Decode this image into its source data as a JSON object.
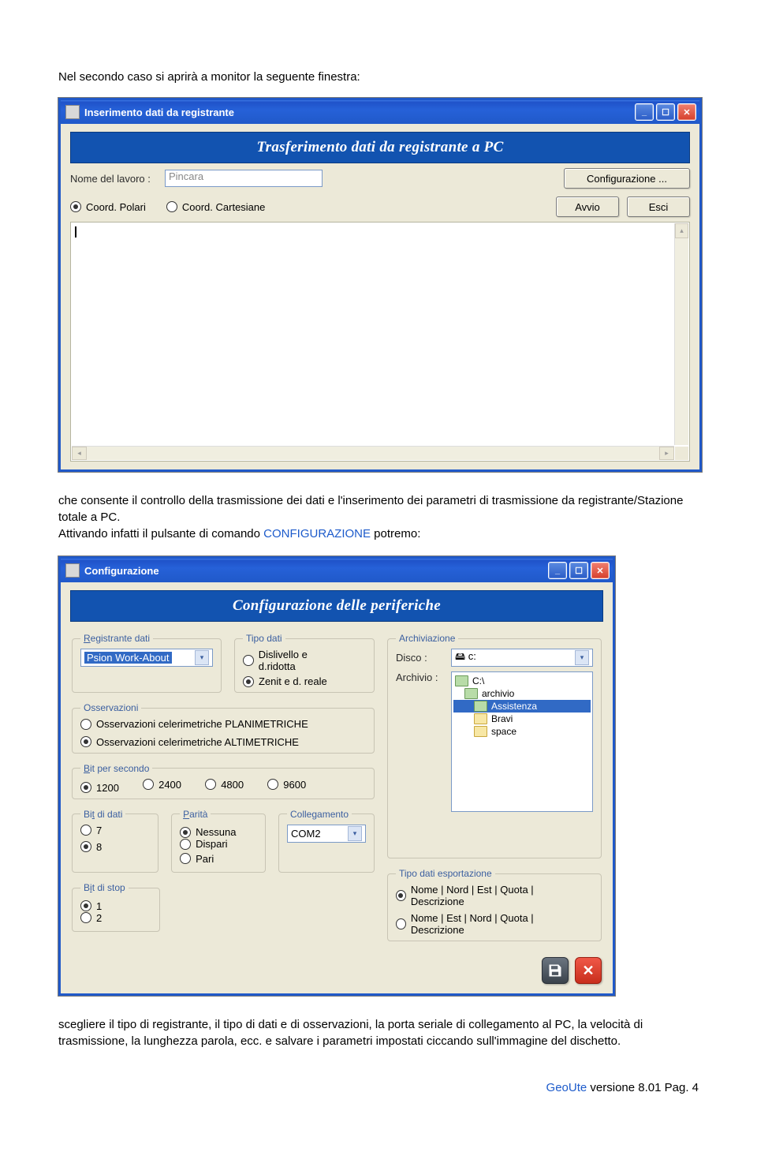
{
  "text": {
    "intro": "Nel secondo caso si aprirà a monitor la seguente finestra:",
    "caption1a": "che consente il controllo della trasmissione dei dati e l'inserimento dei parametri di trasmissione da registrante/Stazione totale a PC.",
    "caption1b": "Attivando infatti il pulsante di comando ",
    "caption1kw": "CONFIGURAZIONE",
    "caption1c": " potremo:",
    "caption2": "scegliere il tipo di registrante, il tipo di dati e di osservazioni, la porta seriale di collegamento al PC, la velocità di trasmissione, la lunghezza parola, ecc. e salvare i parametri impostati ciccando sull'immagine del dischetto."
  },
  "win1": {
    "title": "Inserimento dati da registrante",
    "banner": "Trasferimento dati da registrante a PC",
    "job_label": "Nome del lavoro :",
    "job_value": "Pincara",
    "config_btn": "Configurazione ...",
    "radio_polar": "Coord. Polari",
    "radio_cart": "Coord. Cartesiane",
    "btn_avvio": "Avvio",
    "btn_esci": "Esci"
  },
  "win2": {
    "title": "Configurazione",
    "banner": "Configurazione  delle periferiche",
    "legend_reg": "Registrante dati",
    "reg_value": "Psion Work-About",
    "legend_tipo": "Tipo dati",
    "tipo_a": "Dislivello e d.ridotta",
    "tipo_b": "Zenit e d. reale",
    "legend_oss": "Osservazioni",
    "oss_a": "Osservazioni celerimetriche PLANIMETRICHE",
    "oss_b": "Osservazioni celerimetriche ALTIMETRICHE",
    "legend_bps": "Bit per secondo",
    "bps_1": "1200",
    "bps_2": "2400",
    "bps_3": "4800",
    "bps_4": "9600",
    "legend_bd": "Bit di dati",
    "bd_1": "7",
    "bd_2": "8",
    "legend_par": "Parità",
    "par_a": "Nessuna",
    "par_b": "Dispari",
    "par_c": "Pari",
    "legend_coll": "Collegamento",
    "coll_value": "COM2",
    "legend_bs": "Bit di stop",
    "bs_1": "1",
    "bs_2": "2",
    "legend_arch": "Archiviazione",
    "disco_lbl": "Disco :",
    "disco_val": "c:",
    "arch_lbl": "Archivio :",
    "dir_root": "C:\\",
    "dir_arch": "archivio",
    "dir_ass": "Assistenza",
    "dir_bravi": "Bravi",
    "dir_space": "space",
    "legend_exp": "Tipo dati esportazione",
    "exp_a": "Nome | Nord | Est | Quota | Descrizione",
    "exp_b": "Nome | Est | Nord | Quota | Descrizione"
  },
  "footer": {
    "brand": "GeoUte",
    "ver": " versione 8.01 Pag. 4"
  }
}
